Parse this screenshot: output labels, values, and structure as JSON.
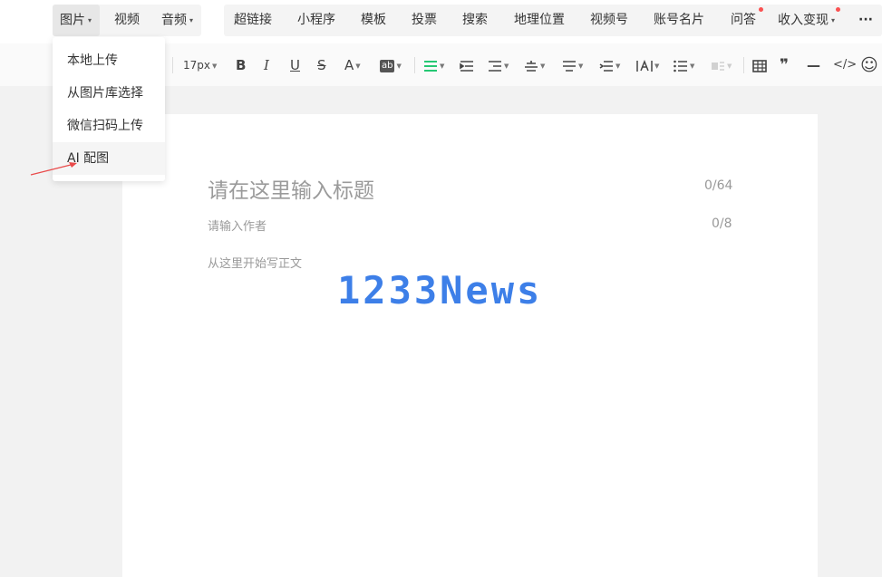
{
  "insert_bar": {
    "image": "图片",
    "video": "视频",
    "audio": "音频",
    "items": [
      "超链接",
      "小程序",
      "模板",
      "投票",
      "搜索",
      "地理位置",
      "视频号",
      "账号名片",
      "问答",
      "收入变现"
    ],
    "more": "···"
  },
  "image_menu": [
    "本地上传",
    "从图片库选择",
    "微信扫码上传",
    "AI 配图"
  ],
  "format_bar": {
    "font_size": "17px",
    "bold": "B",
    "italic": "I",
    "underline": "U",
    "strike": "S",
    "font_color": "A",
    "bg_color": "ab",
    "table_icon": "table-icon",
    "quote": "❞",
    "hr": "—",
    "code": "</>",
    "emoji": "☺"
  },
  "editor": {
    "title_placeholder": "请在这里输入标题",
    "title_count": "0/64",
    "author_placeholder": "请输入作者",
    "author_count": "0/8",
    "body_placeholder": "从这里开始写正文"
  },
  "watermark": "1233News",
  "colors": {
    "accent_green": "#07c160",
    "badge_red": "#fa5151",
    "watermark_blue": "#3d7fe8",
    "annotation_red": "#e94b4b"
  }
}
